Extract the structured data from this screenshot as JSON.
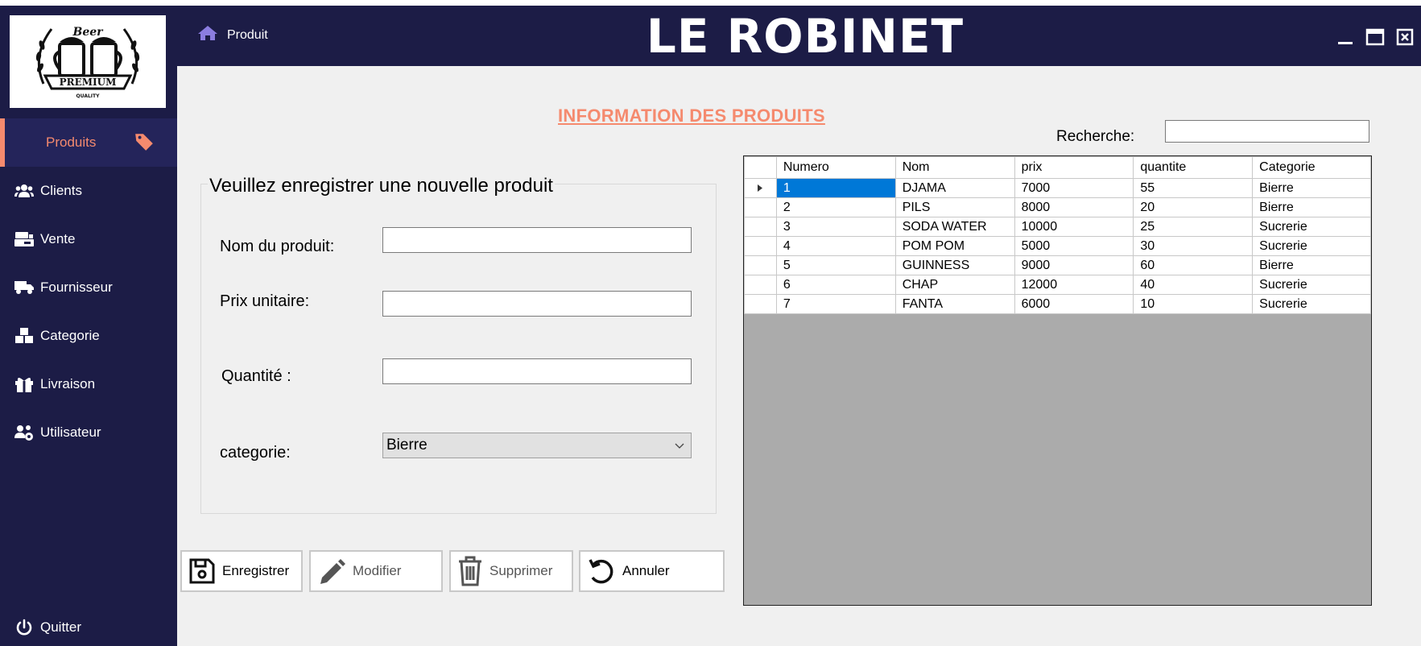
{
  "header": {
    "breadcrumb": "Produit",
    "brand": "LE ROBINET"
  },
  "logo": {
    "top_text": "Beer",
    "banner_text": "PREMIUM",
    "bottom_text": "QUALITY"
  },
  "sidebar": {
    "items": [
      {
        "label": "Produits",
        "icon": "tag-icon",
        "active": true
      },
      {
        "label": "Clients",
        "icon": "users-icon"
      },
      {
        "label": "Vente",
        "icon": "cash-register-icon"
      },
      {
        "label": "Fournisseur",
        "icon": "truck-icon"
      },
      {
        "label": "Categorie",
        "icon": "boxes-icon"
      },
      {
        "label": "Livraison",
        "icon": "gift-icon"
      },
      {
        "label": "Utilisateur",
        "icon": "users-cog-icon"
      },
      {
        "label": "Quitter",
        "icon": "power-icon"
      }
    ]
  },
  "main": {
    "title": "INFORMATION DES PRODUITS",
    "search_label": "Recherche:",
    "search_value": "",
    "form": {
      "title": "Veuillez enregistrer une nouvelle produit",
      "name_label": "Nom du produit:",
      "name_value": "",
      "price_label": "Prix unitaire:",
      "price_value": "",
      "qty_label": "Quantité :",
      "qty_value": "",
      "category_label": "categorie:",
      "category_value": "Bierre"
    },
    "buttons": {
      "save": "Enregistrer",
      "edit": "Modifier",
      "delete": "Supprimer",
      "cancel": "Annuler"
    }
  },
  "table": {
    "columns": [
      "Numero",
      "Nom",
      "prix",
      "quantite",
      "Categorie"
    ],
    "rows": [
      [
        "1",
        "DJAMA",
        "7000",
        "55",
        "Bierre"
      ],
      [
        "2",
        "PILS",
        "8000",
        "20",
        "Bierre"
      ],
      [
        "3",
        "SODA WATER",
        "10000",
        "25",
        "Sucrerie"
      ],
      [
        "4",
        "POM POM",
        "5000",
        "30",
        "Sucrerie"
      ],
      [
        "5",
        "GUINNESS",
        "9000",
        "60",
        "Bierre"
      ],
      [
        "6",
        "CHAP",
        "12000",
        "40",
        "Sucrerie"
      ],
      [
        "7",
        "FANTA",
        "6000",
        "10",
        "Sucrerie"
      ]
    ]
  },
  "colors": {
    "navy": "#1c1c46",
    "accent": "#f58a6e",
    "selection": "#0078d7"
  }
}
